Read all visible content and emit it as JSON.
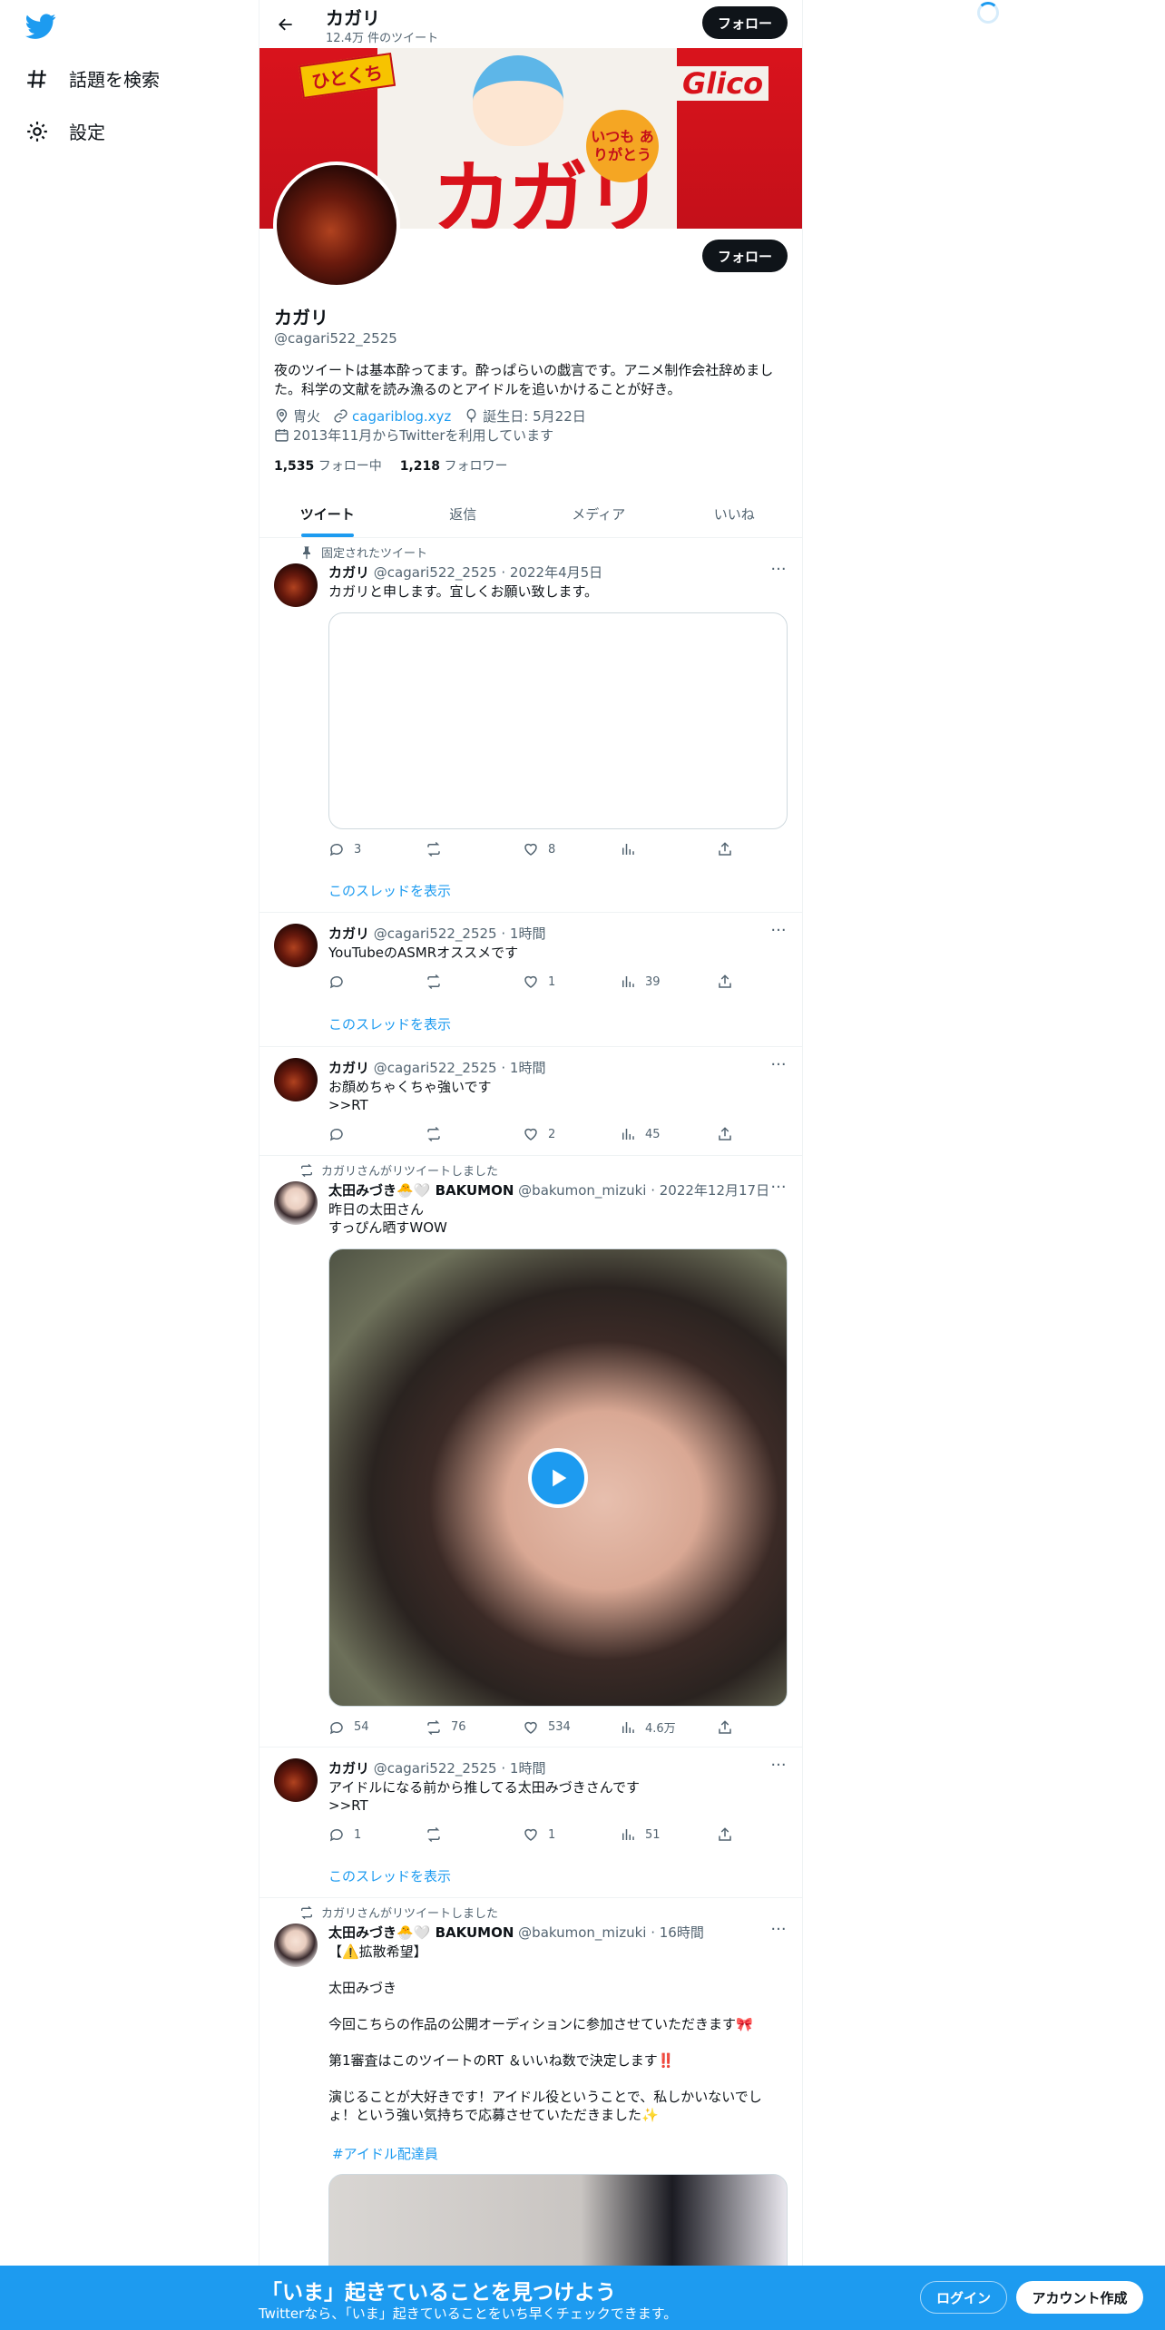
{
  "nav": {
    "explore_label": "話題を検索",
    "settings_label": "設定"
  },
  "header": {
    "name": "カガリ",
    "tweet_count": "12.4万 件のツイート",
    "follow_label": "フォロー"
  },
  "banner": {
    "tag": "ひとくち",
    "brand": "カガリ",
    "bubble": "いつも ありがとう",
    "maker": "Glico"
  },
  "profile": {
    "name": "カガリ",
    "handle": "@cagari522_2525",
    "follow_label": "フォロー",
    "bio": "夜のツイートは基本酔ってます。酔っぱらいの戯言です。アニメ制作会社辞めました。科学の文献を読み漁るのとアイドルを追いかけることが好き。",
    "location": "冑火",
    "link": "cagariblog.xyz",
    "birthday": "誕生日: 5月22日",
    "joined": "2013年11月からTwitterを利用しています",
    "following_count": "1,535",
    "following_label": "フォロー中",
    "followers_count": "1,218",
    "followers_label": "フォロワー"
  },
  "tabs": [
    {
      "label": "ツイート",
      "active": true
    },
    {
      "label": "返信",
      "active": false
    },
    {
      "label": "メディア",
      "active": false
    },
    {
      "label": "いいね",
      "active": false
    }
  ],
  "tweets": [
    {
      "social": "固定されたツイート",
      "name": "カガリ",
      "handle": "@cagari522_2525",
      "time": "2022年4月5日",
      "text": "カガリと申します。宜しくお願い致します。",
      "reply": "3",
      "retweet": "",
      "like": "8",
      "views": "",
      "thread": "このスレッドを表示"
    },
    {
      "name": "カガリ",
      "handle": "@cagari522_2525",
      "time": "1時間",
      "text": "YouTubeのASMRオススメです",
      "reply": "",
      "retweet": "",
      "like": "1",
      "views": "39",
      "thread": "このスレッドを表示"
    },
    {
      "name": "カガリ",
      "handle": "@cagari522_2525",
      "time": "1時間",
      "text": "お顔めちゃくちゃ強いです\n>>RT",
      "reply": "",
      "retweet": "",
      "like": "2",
      "views": "45"
    },
    {
      "social": "カガリさんがリツイートしました",
      "name": "太田みづき🐣🤍 BAKUMON",
      "handle": "@bakumon_mizuki",
      "time": "2022年12月17日",
      "text": "昨日の太田さん\nすっぴん晒すWOW",
      "reply": "54",
      "retweet": "76",
      "like": "534",
      "views": "4.6万"
    },
    {
      "name": "カガリ",
      "handle": "@cagari522_2525",
      "time": "1時間",
      "text": "アイドルになる前から推してる太田みづきさんです\n>>RT",
      "reply": "1",
      "retweet": "",
      "like": "1",
      "views": "51",
      "thread": "このスレッドを表示"
    },
    {
      "social": "カガリさんがリツイートしました",
      "name": "太田みづき🐣🤍 BAKUMON",
      "handle": "@bakumon_mizuki",
      "time": "16時間",
      "text": "【⚠️拡散希望】\n\n太田みづき\n\n今回こちらの作品の公開オーディションに参加させていただきます🎀\n\n第1審査はこのツイートのRT ＆いいね数で決定します‼️\n\n演じることが大好きです！アイドル役ということで、私しかいないでしょ！という強い気持ちで応募させていただきました✨",
      "hashtag": "#アイドル配達員"
    }
  ],
  "bottom_bar": {
    "title": "「いま」起きていることを見つけよう",
    "subtitle": "Twitterなら、「いま」起きていることをいち早くチェックできます。",
    "login_label": "ログイン",
    "signup_label": "アカウント作成"
  }
}
